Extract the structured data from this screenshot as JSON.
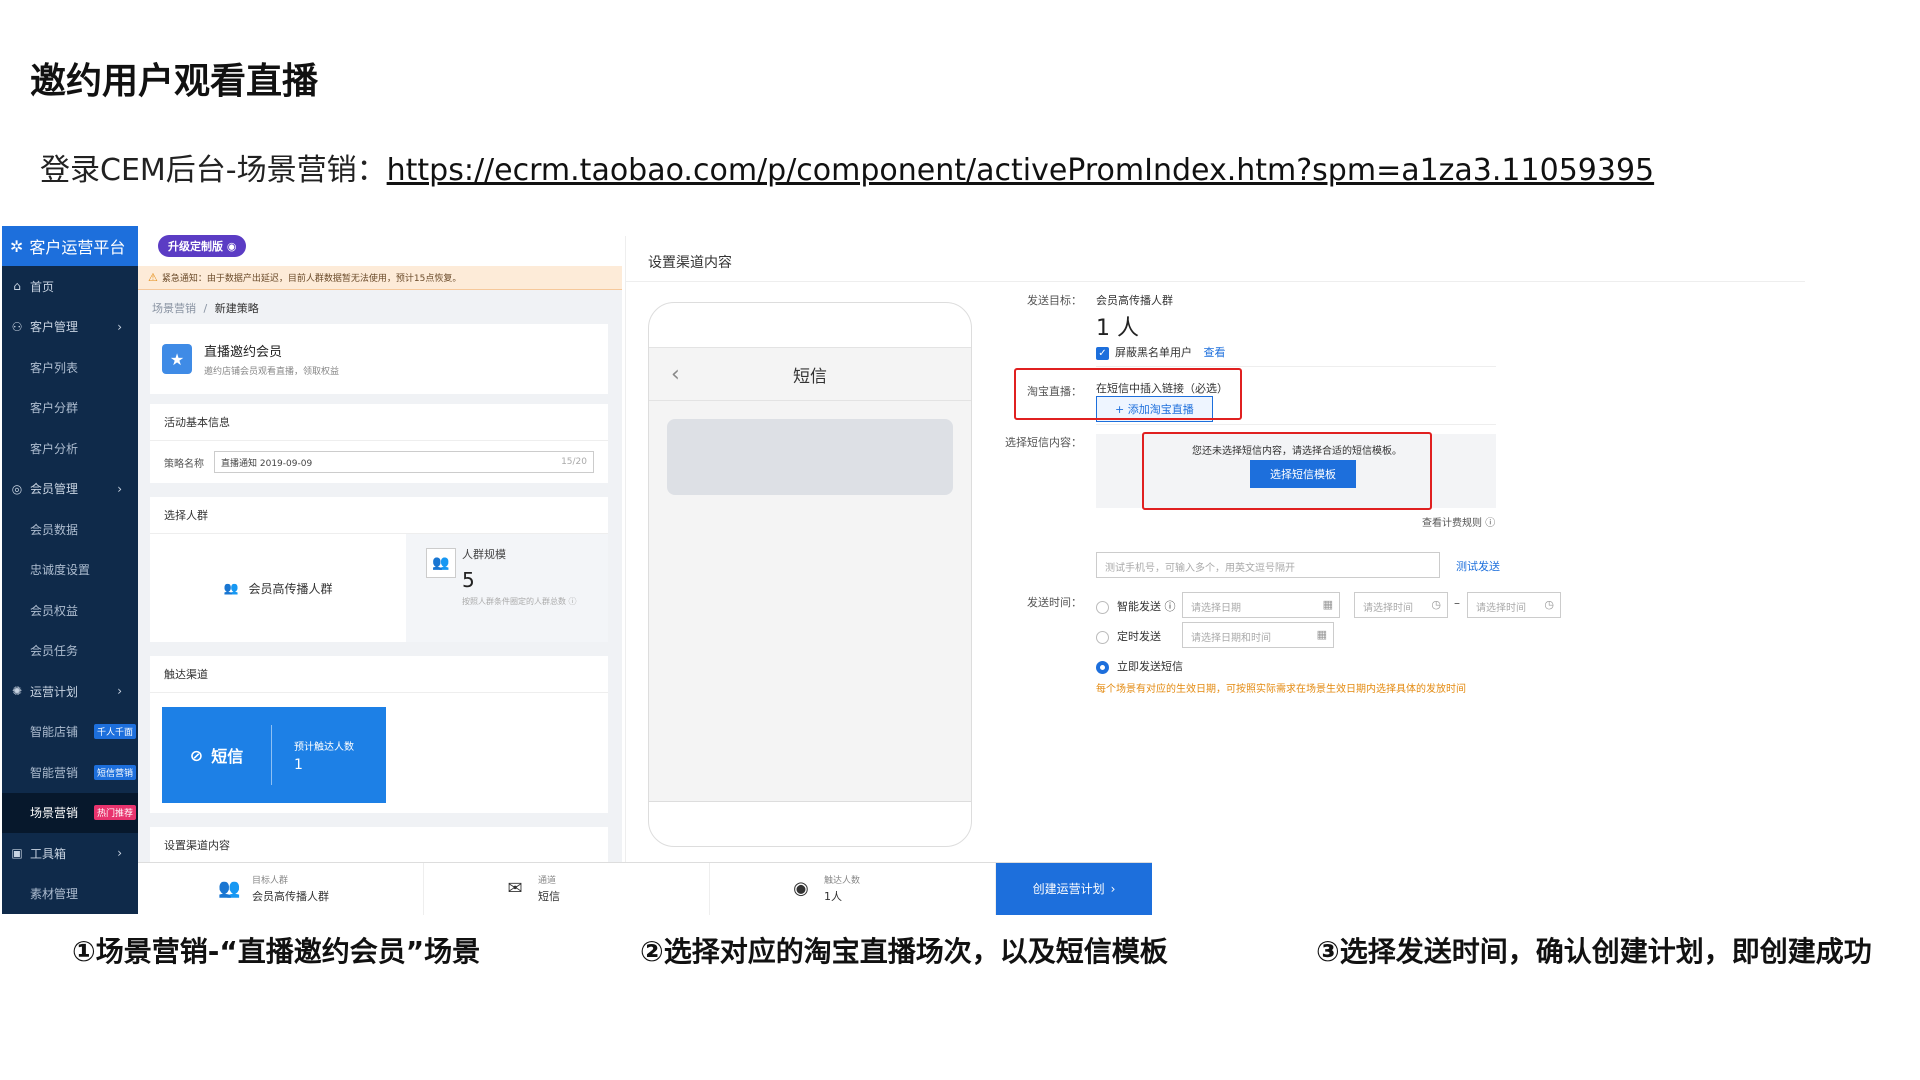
{
  "slide": {
    "title": "邀约用户观看直播",
    "login_prefix": "登录CEM后台-场景营销：",
    "login_url": "https://ecrm.taobao.com/p/component/activePromIndex.htm?spm=a1za3.11059395"
  },
  "sidebar": {
    "brand": "客户运营平台",
    "items": [
      {
        "label": "首页",
        "icon": "home-icon",
        "sub": false,
        "chevron": false
      },
      {
        "label": "客户管理",
        "icon": "users-icon",
        "sub": false,
        "chevron": true
      },
      {
        "label": "客户列表",
        "sub": true
      },
      {
        "label": "客户分群",
        "sub": true
      },
      {
        "label": "客户分析",
        "sub": true
      },
      {
        "label": "会员管理",
        "icon": "member-icon",
        "sub": false,
        "chevron": true
      },
      {
        "label": "会员数据",
        "sub": true
      },
      {
        "label": "忠诚度设置",
        "sub": true
      },
      {
        "label": "会员权益",
        "sub": true
      },
      {
        "label": "会员任务",
        "sub": true
      },
      {
        "label": "运营计划",
        "icon": "bulb-icon",
        "sub": false,
        "chevron": true
      },
      {
        "label": "智能店铺",
        "sub": true,
        "tag": "千人千面",
        "tag_color": "blue"
      },
      {
        "label": "智能营销",
        "sub": true,
        "tag": "短信营销",
        "tag_color": "blue"
      },
      {
        "label": "场景营销",
        "sub": true,
        "tag": "热门推荐",
        "tag_color": "pink",
        "active": true
      },
      {
        "label": "工具箱",
        "icon": "toolbox-icon",
        "sub": false,
        "chevron": true
      },
      {
        "label": "素材管理",
        "sub": true
      }
    ]
  },
  "console": {
    "upgrade_badge": "升级定制版",
    "alert": "紧急通知：由于数据产出延迟，目前人群数据暂无法使用，预计15点恢复。",
    "breadcrumb_root": "场景营销",
    "breadcrumb_sep": "/",
    "breadcrumb_current": "新建策略",
    "strategy_title": "直播邀约会员",
    "strategy_desc": "邀约店铺会员观看直播，领取权益",
    "basic_info_title": "活动基本信息",
    "name_label": "策略名称",
    "name_value": "直播通知 2019-09-09",
    "name_count": "15/20",
    "crowd_title": "选择人群",
    "crowd_name": "会员高传播人群",
    "crowd_size_label": "人群规模",
    "crowd_size_value": "5",
    "crowd_size_note": "按照人群条件圈定的人群总数",
    "channel_title": "触达渠道",
    "channel_name": "短信",
    "channel_reach_label": "预计触达人数",
    "channel_reach_value": "1",
    "content_title": "设置渠道内容"
  },
  "bottom_bar": {
    "target_label": "目标人群",
    "target_value": "会员高传播人群",
    "channel_label": "通道",
    "channel_value": "短信",
    "reach_label": "触达人数",
    "reach_value": "1人",
    "create_label": "创建运营计划"
  },
  "channel_panel": {
    "title": "设置渠道内容",
    "phone_title": "短信",
    "target_label": "发送目标：",
    "target_value": "会员高传播人群",
    "target_count": "1 人",
    "blacklist_label": "屏蔽黑名单用户",
    "blacklist_link": "查看",
    "live_label": "淘宝直播：",
    "live_hint": "在短信中插入链接（必选）",
    "live_button": "+ 添加淘宝直播",
    "sms_content_label": "选择短信内容：",
    "sms_empty": "您还未选择短信内容，请选择合适的短信模板。",
    "sms_template_button": "选择短信模板",
    "billing_rule": "查看计费规则",
    "test_placeholder": "测试手机号，可输入多个，用英文逗号隔开",
    "test_button": "测试发送",
    "send_time_label": "发送时间：",
    "opt_smart": "智能发送",
    "opt_scheduled": "定时发送",
    "opt_now": "立即发送短信",
    "date_placeholder": "请选择日期",
    "time_placeholder": "请选择时间",
    "datetime_placeholder": "请选择日期和时间",
    "range_sep": "–",
    "warn": "每个场景有对应的生效日期，可按照实际需求在场景生效日期内选择具体的发放时间",
    "selected_option": "立即发送短信"
  },
  "captions": {
    "step1": "①场景营销-“直播邀约会员”场景",
    "step2": "②选择对应的淘宝直播场次，以及短信模板",
    "step3": "③选择发送时间，确认创建计划，即创建成功"
  },
  "colors": {
    "accent": "#1d6fdc",
    "sidebar_bg": "#0f2a4a",
    "highlight_red": "#e02020",
    "warn_orange": "#e38a10"
  }
}
